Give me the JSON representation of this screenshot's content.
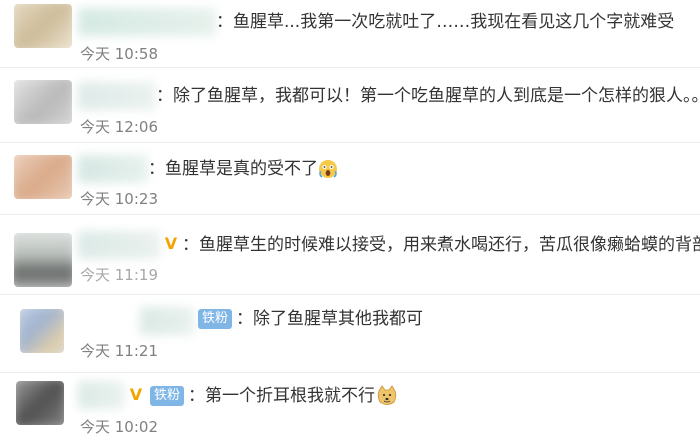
{
  "comments": [
    {
      "text": "：鱼腥草...我第一次吃就吐了……我现在看见这几个字就难受",
      "time": "今天 10:58"
    },
    {
      "text": "：除了鱼腥草，我都可以！第一个吃鱼腥草的人到底是一个怎样的狠人。。",
      "time": "今天 12:06"
    },
    {
      "text": "：鱼腥草是真的受不了",
      "emoji_icon": "screaming-face-emoji",
      "time": "今天 10:23"
    },
    {
      "text": "：鱼腥草生的时候难以接受，用来煮水喝还行，苦瓜很像癞蛤蟆的背部",
      "vip_icon": "vip-v-icon",
      "time": "今天 11:19"
    },
    {
      "text": "：除了鱼腥草其他我都可",
      "badge": "铁粉",
      "time": "今天 11:21"
    },
    {
      "text": "：第一个折耳根我就不行",
      "vip_icon": "vip-v-icon",
      "badge": "铁粉",
      "emoji_icon": "doge-emoji",
      "time": "今天 10:02"
    }
  ]
}
